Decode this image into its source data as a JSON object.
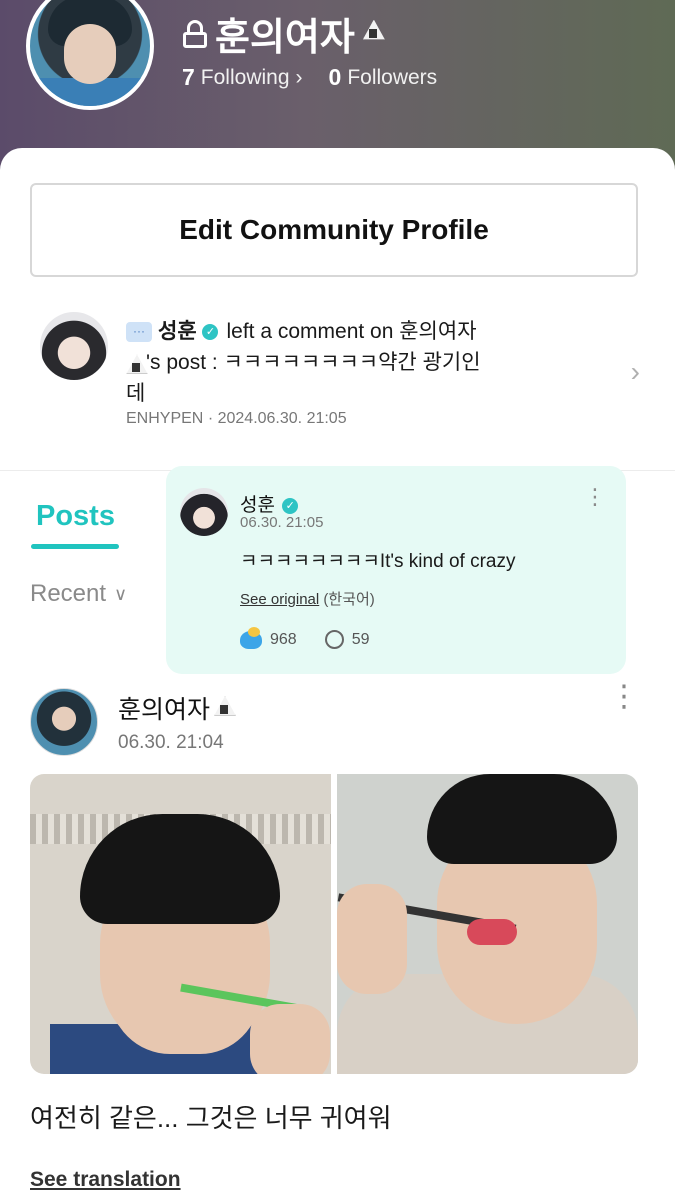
{
  "profile": {
    "name": "훈의여자",
    "following_count": "7",
    "following_label": "Following",
    "followers_count": "0",
    "followers_label": "Followers"
  },
  "edit_button": {
    "label": "Edit Community Profile"
  },
  "notification": {
    "user": "성훈",
    "text_1": "left a comment on 훈의여자",
    "text_2": "'s post : ㅋㅋㅋㅋㅋㅋㅋㅋ약간 광기인",
    "text_3": "데",
    "community": "ENHYPEN",
    "separator": "·",
    "timestamp": "2024.06.30. 21:05"
  },
  "tabs": {
    "posts_label": "Posts"
  },
  "sort": {
    "label": "Recent"
  },
  "comment_popup": {
    "name": "성훈",
    "time": "06.30. 21:05",
    "body": "ㅋㅋㅋㅋㅋㅋㅋㅋIt's kind of crazy",
    "see_original": "See original",
    "original_language": "(한국어)",
    "likes": "968",
    "comments": "59"
  },
  "post": {
    "author": "훈의여자",
    "time": "06.30. 21:04",
    "caption": "여전히 같은... 그것은 너무 귀여워",
    "see_translation": "See translation"
  },
  "icons": [
    "lock-icon",
    "chevron-right-icon",
    "chat-bubble-icon",
    "verified-icon",
    "rice-ball-icon",
    "chevron-down-icon",
    "more-vertical-icon",
    "heart-icon",
    "comment-icon"
  ],
  "colors": {
    "accent": "#20c4bf",
    "popup_bg": "#e6faf5",
    "verified": "#2ec4c4"
  }
}
